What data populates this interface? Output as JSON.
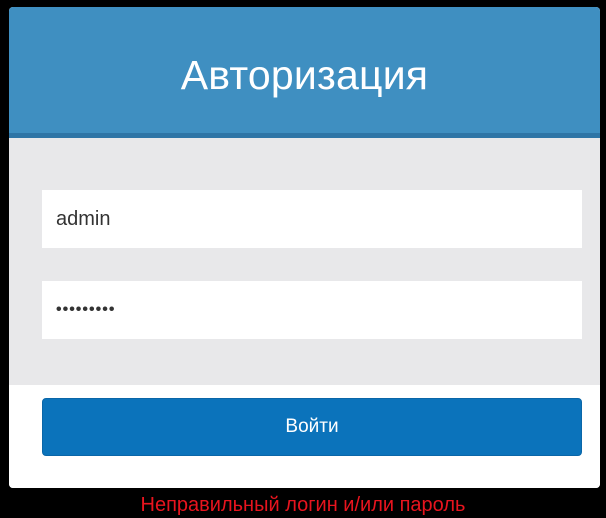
{
  "header": {
    "title": "Авторизация"
  },
  "form": {
    "login_value": "admin",
    "password_value": "•••••••••"
  },
  "footer": {
    "submit_label": "Войти"
  },
  "error": {
    "message": "Неправильный логин и/или пароль"
  },
  "colors": {
    "header_bg": "#3f8fc1",
    "button_bg": "#0b73bb",
    "error_text": "#e8141e"
  }
}
